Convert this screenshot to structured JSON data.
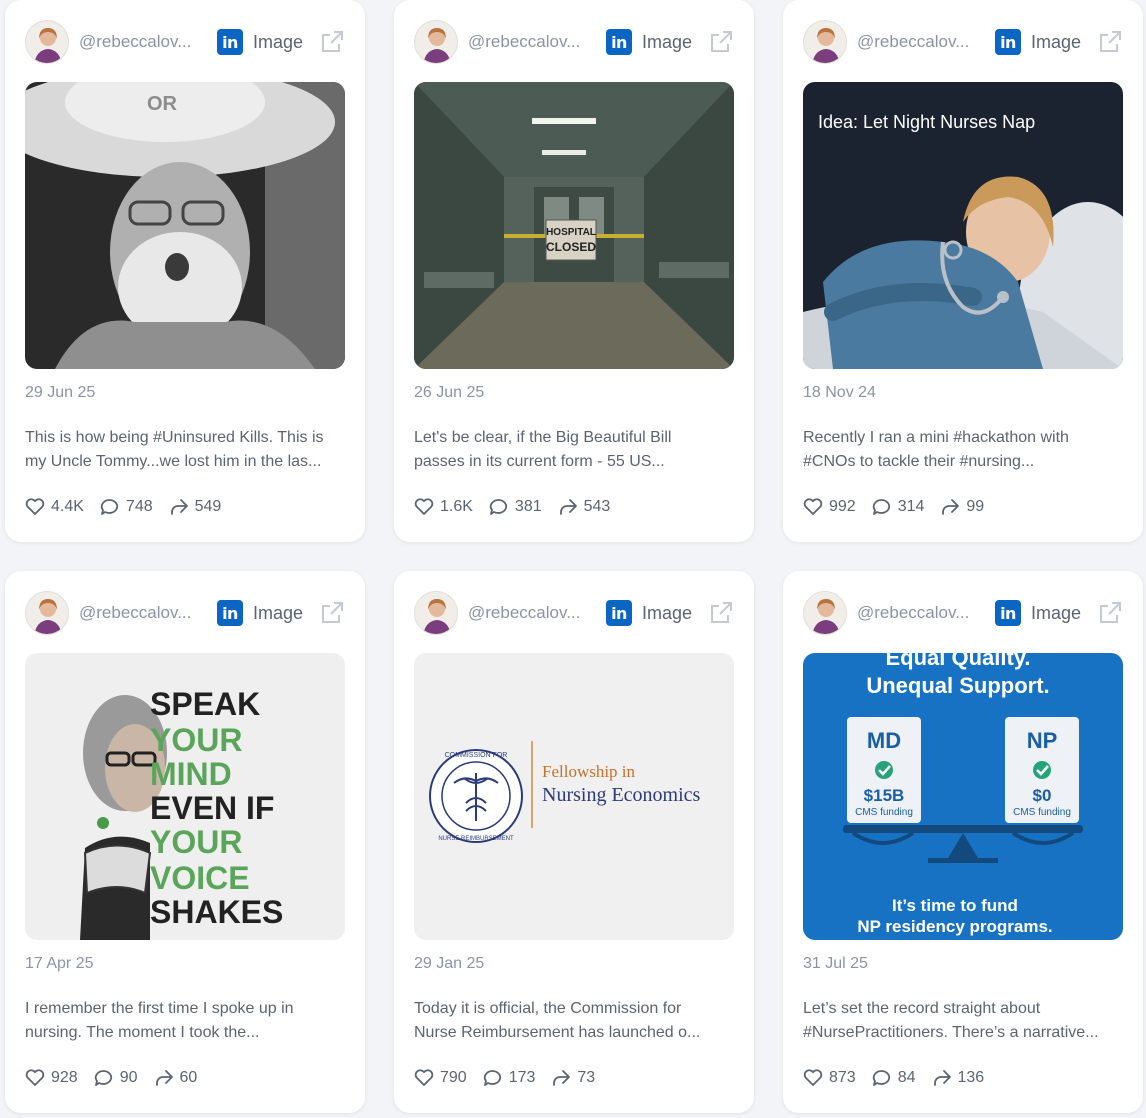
{
  "colors": {
    "linkedin": "#0a66c2",
    "text": "#5a6473",
    "muted": "#8a94a6",
    "card_bg": "#ffffff",
    "page_bg": "#f3f4f7"
  },
  "cards": [
    {
      "handle": "@rebeccalov...",
      "platform_badge": "in",
      "type": "Image",
      "date": "29 Jun 25",
      "excerpt": [
        "This is how being #Uninsured Kills. This is",
        "my Uncle Tommy...we lost him in the las..."
      ],
      "likes": "4.4K",
      "comments": "748",
      "shares": "549",
      "media_text": {
        "cap": "OR"
      }
    },
    {
      "handle": "@rebeccalov...",
      "platform_badge": "in",
      "type": "Image",
      "date": "26 Jun 25",
      "excerpt": [
        "Let's be clear, if the Big Beautiful Bill",
        "passes in its current form - 55 US..."
      ],
      "likes": "1.6K",
      "comments": "381",
      "shares": "543",
      "media_text": {
        "sign_1": "HOSPITAL",
        "sign_2": "CLOSED"
      }
    },
    {
      "handle": "@rebeccalov...",
      "platform_badge": "in",
      "type": "Image",
      "date": "18 Nov 24",
      "excerpt": [
        "Recently I ran a mini #hackathon with",
        "#CNOs to tackle their #nursing..."
      ],
      "likes": "992",
      "comments": "314",
      "shares": "99",
      "media_text": {
        "caption": "Idea: Let Night Nurses Nap"
      }
    },
    {
      "handle": "@rebeccalov...",
      "platform_badge": "in",
      "type": "Image",
      "date": "17 Apr 25",
      "excerpt": [
        "I remember the first time I spoke up in",
        "nursing. The moment I took the..."
      ],
      "likes": "928",
      "comments": "90",
      "shares": "60",
      "media_text": {
        "lines": [
          "SPEAK",
          "YOUR",
          "MIND",
          "EVEN IF",
          "YOUR",
          "VOICE",
          "SHAKES"
        ]
      }
    },
    {
      "handle": "@rebeccalov...",
      "platform_badge": "in",
      "type": "Image",
      "date": "29 Jan 25",
      "excerpt": [
        "Today it is official, the Commission for",
        "Nurse Reimbursement has launched o..."
      ],
      "likes": "790",
      "comments": "173",
      "shares": "73",
      "media_text": {
        "title_1": "Fellowship in",
        "title_2": "Nursing Economics",
        "seal_top": "COMMISSION FOR",
        "seal_bottom": "NURSE REIMBURSEMENT"
      }
    },
    {
      "handle": "@rebeccalov...",
      "platform_badge": "in",
      "type": "Image",
      "date": "31 Jul 25",
      "excerpt": [
        "Let’s set the record straight about",
        "#NursePractitioners. There’s a narrative..."
      ],
      "likes": "873",
      "comments": "84",
      "shares": "136",
      "media_text": {
        "head_1": "Equal Quality.",
        "head_2": "Unequal Support.",
        "left_title": "MD",
        "left_amount": "$15B",
        "left_note": "CMS funding",
        "right_title": "NP",
        "right_amount": "$0",
        "right_note": "CMS funding",
        "foot_1": "It’s time to fund",
        "foot_2": "NP residency programs."
      }
    }
  ]
}
